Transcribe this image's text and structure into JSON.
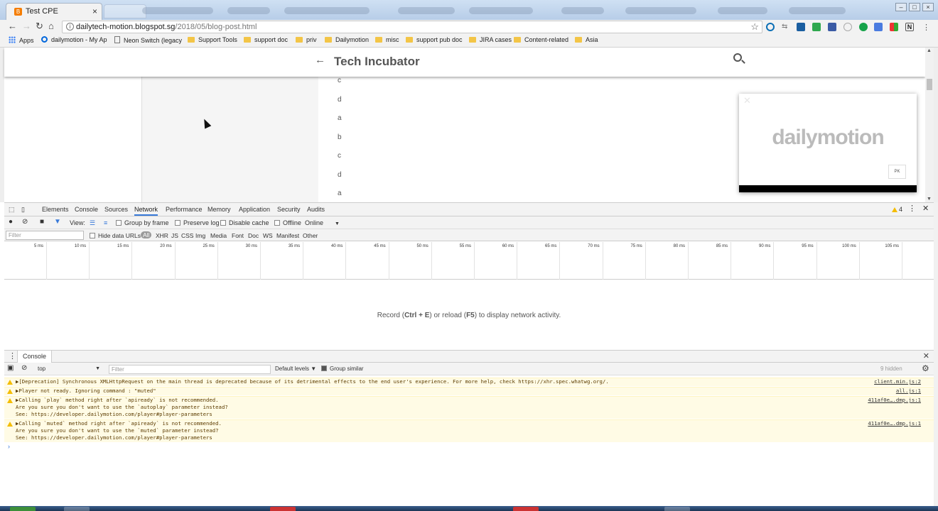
{
  "browser": {
    "tab_title": "Test CPE",
    "tab_close": "×",
    "url_host": "dailytech-motion.blogspot.sg",
    "url_path": "/2018/05/blog-post.html",
    "bookmarks": [
      "Apps",
      "dailymotion - My Ap",
      "Neon Switch (legacy",
      "Support Tools",
      "support doc",
      "priv",
      "Dailymotion",
      "misc",
      "support pub doc",
      "JIRA cases",
      "Content-related",
      "Asia"
    ]
  },
  "page": {
    "title": "Tech Incubator",
    "letters": [
      "c",
      "d",
      "a",
      "b",
      "c",
      "d",
      "a"
    ],
    "player_logo": "dailymotion",
    "player_badge": "PK"
  },
  "devtools": {
    "tabs": [
      "Elements",
      "Console",
      "Sources",
      "Network",
      "Performance",
      "Memory",
      "Application",
      "Security",
      "Audits"
    ],
    "selected_tab": "Network",
    "warning_count": "4",
    "network_toolbar": {
      "view_label": "View:",
      "group_by_frame": "Group by frame",
      "preserve_log": "Preserve log",
      "disable_cache": "Disable cache",
      "offline": "Offline",
      "throttle": "Online"
    },
    "filter_placeholder": "Filter",
    "hide_data_urls": "Hide data URLs",
    "filter_types": [
      "All",
      "XHR",
      "JS",
      "CSS",
      "Img",
      "Media",
      "Font",
      "Doc",
      "WS",
      "Manifest",
      "Other"
    ],
    "timeline_ticks": [
      "5 ms",
      "10 ms",
      "15 ms",
      "20 ms",
      "25 ms",
      "30 ms",
      "35 ms",
      "40 ms",
      "45 ms",
      "50 ms",
      "55 ms",
      "60 ms",
      "65 ms",
      "70 ms",
      "75 ms",
      "80 ms",
      "85 ms",
      "90 ms",
      "95 ms",
      "100 ms",
      "105 ms"
    ],
    "empty_msg_pre": "Record (",
    "empty_key1": "Ctrl + E",
    "empty_msg_mid": ") or reload (",
    "empty_key2": "F5",
    "empty_msg_post": ") to display network activity."
  },
  "console": {
    "tab_label": "Console",
    "context": "top",
    "filter_placeholder": "Filter",
    "levels": "Default levels ▼",
    "group_similar": "Group similar",
    "hidden_count": "9 hidden",
    "messages": [
      {
        "line1": "▶[Deprecation] Synchronous XMLHttpRequest on the main thread is deprecated because of its detrimental effects to the end user's experience. For more help, check ",
        "link": "https://xhr.spec.whatwg.org/",
        "tail": ".",
        "source": "client.min.js:2"
      },
      {
        "line1": "▶Player not ready. Ignoring command : \"muted\"",
        "source": "all.js:1"
      },
      {
        "line1": "▶Calling `play` method right after `apiready` is not recommended.",
        "line2": "Are you sure you don't want to use the `autoplay` parameter instead?",
        "line3_pre": "See: ",
        "link": "https://developer.dailymotion.com/player#player-parameters",
        "source": "411af0e….dmp.js:1"
      },
      {
        "line1": "▶Calling `muted` method right after `apiready` is not recommended.",
        "line2": "Are you sure you don't want to use the `muted` parameter instead?",
        "line3_pre": "See: ",
        "link": "https://developer.dailymotion.com/player#player-parameters",
        "source": "411af0e….dmp.js:1"
      }
    ],
    "prompt": "›"
  }
}
